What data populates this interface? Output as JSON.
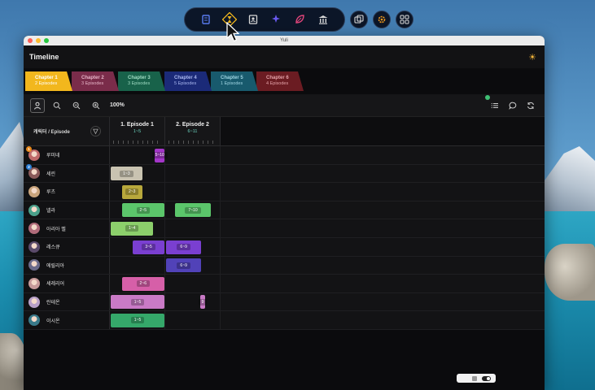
{
  "window": {
    "title": "Yuli"
  },
  "app": {
    "title": "Timeline"
  },
  "dock": {
    "items": [
      "scroll-icon",
      "hourglass-icon",
      "contact-icon",
      "sparkle-icon",
      "leaf-icon",
      "bank-icon"
    ],
    "extras": [
      "images-icon",
      "gear-icon",
      "grid-icon"
    ]
  },
  "tabs": [
    {
      "name": "Chapter 1",
      "sub": "2 Episodes",
      "bg": "#f2b71d",
      "fg": "#ffffff",
      "active": true
    },
    {
      "name": "Chapter 2",
      "sub": "3 Episodes",
      "bg": "#7a2c4a",
      "fg": "#e7b6c9"
    },
    {
      "name": "Chapter 3",
      "sub": "3 Episodes",
      "bg": "#18624a",
      "fg": "#9fdcc3"
    },
    {
      "name": "Chapter 4",
      "sub": "5 Episodes",
      "bg": "#1b2a78",
      "fg": "#aab8f0"
    },
    {
      "name": "Chapter 5",
      "sub": "1 Episodes",
      "bg": "#185a6d",
      "fg": "#9fd5e2"
    },
    {
      "name": "Chapter 6",
      "sub": "4 Episodes",
      "bg": "#6b1c22",
      "fg": "#e3a2a8"
    }
  ],
  "toolbar": {
    "zoom": "100%"
  },
  "grid": {
    "corner_label": "캐릭터 / Episode",
    "episodes": [
      {
        "title": "1. Episode 1",
        "range": "1~5"
      },
      {
        "title": "2. Episode 2",
        "range": "6~11"
      }
    ],
    "rows": [
      {
        "name": "루미네",
        "avatar": "#c06a6a",
        "badge": "1",
        "badge_color": "#e8891d"
      },
      {
        "name": "세린",
        "avatar": "#8a5a5a",
        "badge": "2",
        "badge_color": "#2d7fd6"
      },
      {
        "name": "루츠",
        "avatar": "#c9a47c"
      },
      {
        "name": "넬라",
        "avatar": "#4ba08a"
      },
      {
        "name": "아리아 벨",
        "avatar": "#b06b7a"
      },
      {
        "name": "레스큐",
        "avatar": "#5a4a6a"
      },
      {
        "name": "에릴리아",
        "avatar": "#6a6a8a"
      },
      {
        "name": "세레리어",
        "avatar": "#c79a9a"
      },
      {
        "name": "란테온",
        "avatar": "#b8a0c8"
      },
      {
        "name": "이시온",
        "avatar": "#3a7a8a"
      }
    ]
  },
  "bars": [
    {
      "row": 0,
      "label": "5~10",
      "color": "#a436c9"
    },
    {
      "row": 1,
      "label": "1~3",
      "color": "#c9c3b1"
    },
    {
      "row": 2,
      "label": "2~3",
      "color": "#b8a83c"
    },
    {
      "row": 3,
      "label": "2~5",
      "color": "#5bc66b"
    },
    {
      "row": 3,
      "label": "7~10",
      "color": "#5bc66b"
    },
    {
      "row": 4,
      "label": "1~4",
      "color": "#8ccf6b"
    },
    {
      "row": 5,
      "label": "3~5",
      "color": "#7a3fd1"
    },
    {
      "row": 5,
      "label": "6~9",
      "color": "#7a3fd1"
    },
    {
      "row": 6,
      "label": "6~9",
      "color": "#5142b8"
    },
    {
      "row": 7,
      "label": "2~6",
      "color": "#d65fa8"
    },
    {
      "row": 8,
      "label": "1~5",
      "color": "#c97ac6"
    },
    {
      "row": 8,
      "label": "9",
      "color": "#c97ac6"
    },
    {
      "row": 9,
      "label": "1~5",
      "color": "#35a86a"
    }
  ]
}
